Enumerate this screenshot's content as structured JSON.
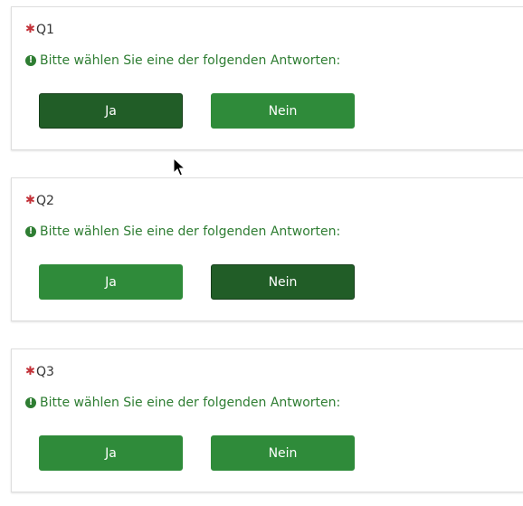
{
  "questions": [
    {
      "code": "Q1",
      "help_text": "Bitte wählen Sie eine der folgenden Antworten:",
      "options": [
        "Ja",
        "Nein"
      ],
      "selected": "Ja"
    },
    {
      "code": "Q2",
      "help_text": "Bitte wählen Sie eine der folgenden Antworten:",
      "options": [
        "Ja",
        "Nein"
      ],
      "selected": "Nein"
    },
    {
      "code": "Q3",
      "help_text": "Bitte wählen Sie eine der folgenden Antworten:",
      "options": [
        "Ja",
        "Nein"
      ],
      "selected": ""
    }
  ],
  "icons": {
    "mandatory": "asterisk-icon",
    "help": "alert-circle-icon",
    "pointer": "mouse-cursor-icon"
  },
  "colors": {
    "accent_green": "#2f8b3a",
    "selected_green": "#215d27",
    "help_text_green": "#2e7d32",
    "mandatory_red": "#c3333a"
  }
}
